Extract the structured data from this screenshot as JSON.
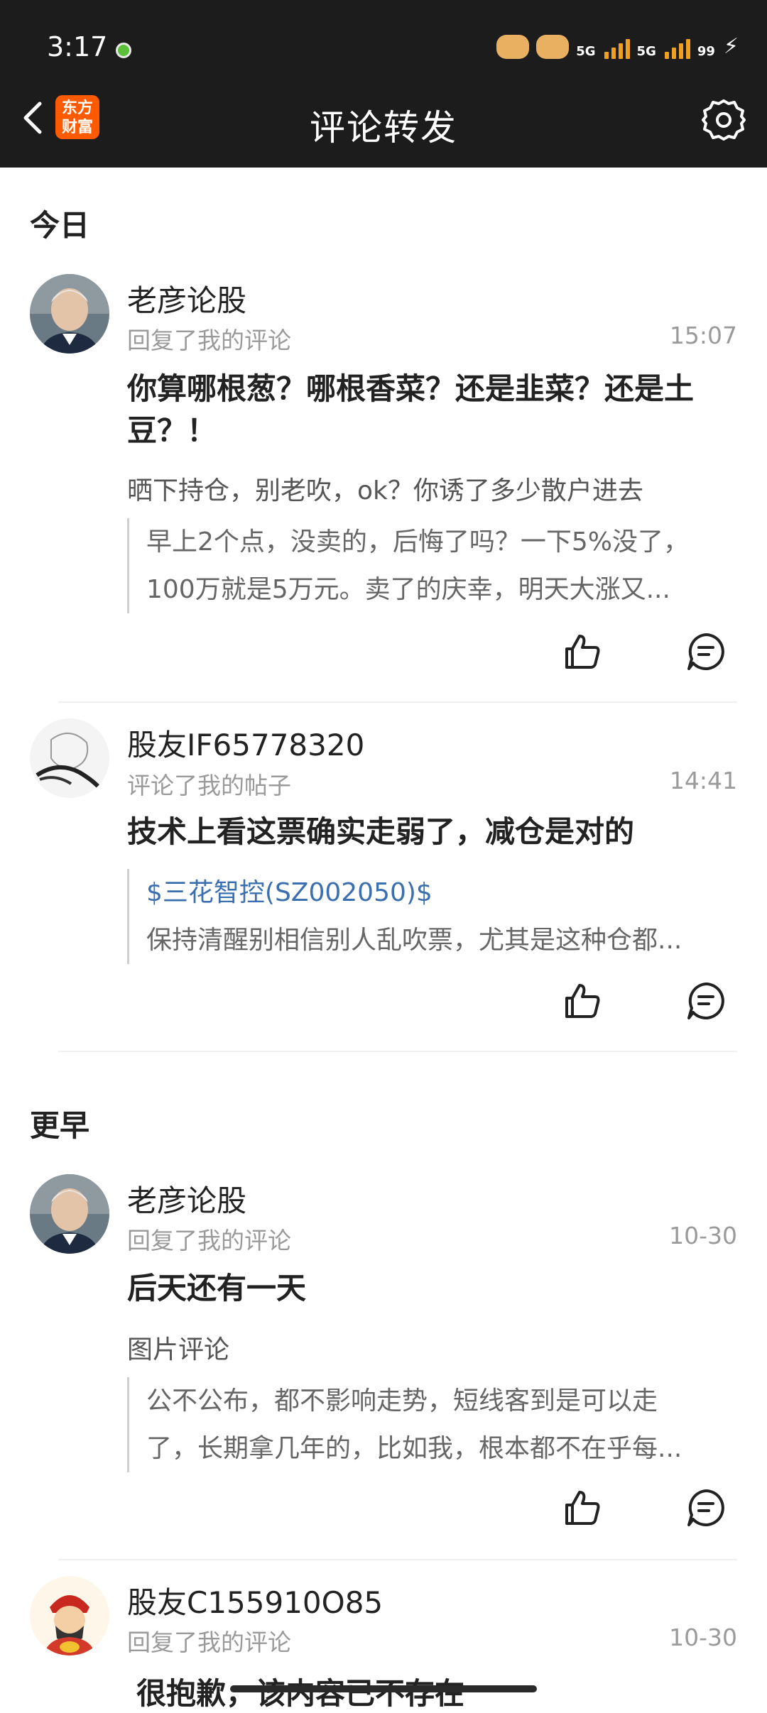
{
  "status_bar": {
    "time": "3:17",
    "network": "5G",
    "network2": "5G",
    "battery": "99"
  },
  "nav": {
    "title": "评论转发",
    "logo_text": "东方财富"
  },
  "sections": {
    "today": "今日",
    "earlier": "更早"
  },
  "items": [
    {
      "name": "老彦论股",
      "action": "回复了我的评论",
      "time": "15:07",
      "main_text": "你算哪根葱？哪根香菜？还是韭菜？还是土豆？！",
      "sub_text": "晒下持仓，别老吹，ok？你诱了多少散户进去",
      "quote_line1": "早上2个点，没卖的，后悔了吗？一下5%没了，",
      "quote_line2": "100万就是5万元。卖了的庆幸，明天大涨又..."
    },
    {
      "name": "股友IF65778320",
      "action": "评论了我的帖子",
      "time": "14:41",
      "main_text": "技术上看这票确实走弱了，减仓是对的",
      "quote_link": "$三花智控(SZ002050)$",
      "quote_line2": "保持清醒别相信别人乱吹票，尤其是这种仓都..."
    },
    {
      "name": "老彦论股",
      "action": "回复了我的评论",
      "time": "10-30",
      "main_text": "后天还有一天",
      "sub_text": "图片评论",
      "quote_line1": "公不公布，都不影响走势，短线客到是可以走",
      "quote_line2": "了，长期拿几年的，比如我，根本都不在乎每..."
    },
    {
      "name": "股友C155910O85",
      "action": "回复了我的评论",
      "time": "10-30",
      "main_text": "很抱歉，该内容已不存在"
    }
  ]
}
